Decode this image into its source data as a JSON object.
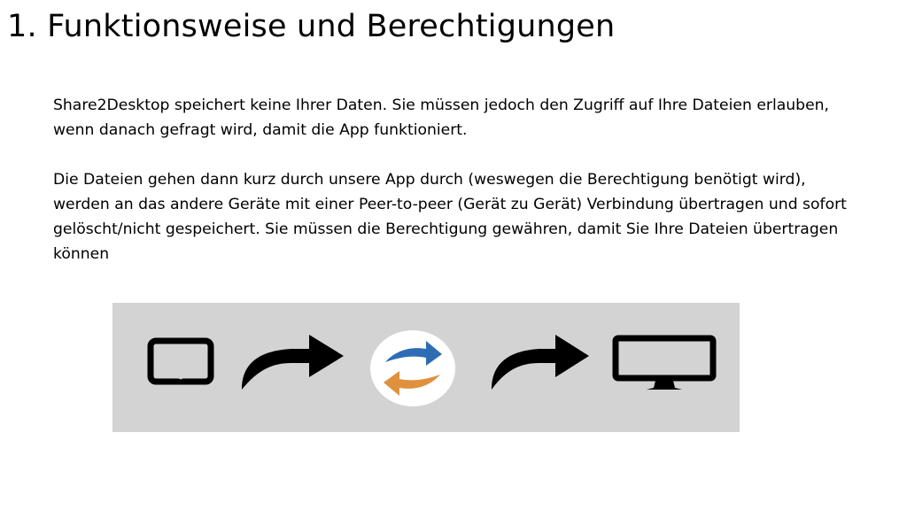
{
  "slide": {
    "title": "1. Funktionsweise und Berechtigungen",
    "paragraphs": [
      "Share2Desktop speichert keine Ihrer Daten. Sie müssen jedoch den Zugriff auf Ihre Dateien erlauben, wenn danach gefragt wird, damit die App funktioniert.",
      "Die Dateien gehen dann kurz durch unsere App durch (weswegen die Berechtigung benötigt wird), werden an das andere Geräte mit einer Peer-to-peer (Gerät zu Gerät) Verbindung übertragen und sofort gelöscht/nicht gespeichert. Sie müssen die Berechtigung gewähren, damit Sie Ihre Dateien übertragen können"
    ]
  },
  "flow_diagram": {
    "background": "#d3d3d3",
    "icons": [
      "tablet-icon",
      "curved-arrow-icon",
      "sync-icon",
      "curved-arrow-icon",
      "monitor-icon"
    ],
    "colors": {
      "icon": "#000000",
      "sync_circle": "#ffffff",
      "sync_top_arrow": "#2e6db4",
      "sync_bottom_arrow": "#e0913e"
    }
  }
}
